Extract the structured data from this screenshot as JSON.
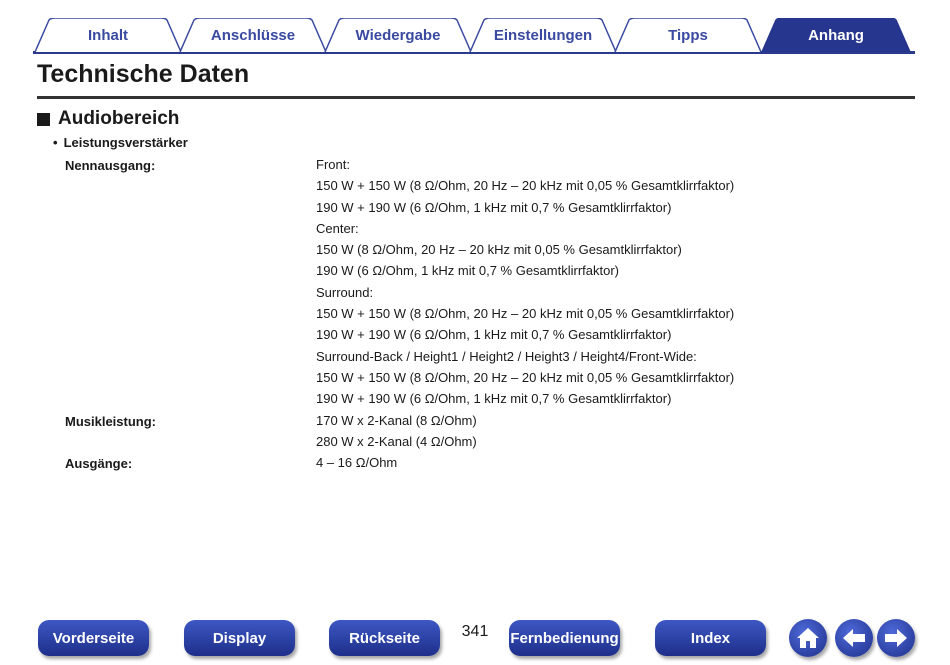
{
  "tabs": [
    {
      "label": "Inhalt"
    },
    {
      "label": "Anschlüsse"
    },
    {
      "label": "Wiedergabe"
    },
    {
      "label": "Einstellungen"
    },
    {
      "label": "Tipps"
    },
    {
      "label": "Anhang"
    }
  ],
  "active_tab": "Anhang",
  "page_title": "Technische Daten",
  "section": {
    "title": "Audiobereich"
  },
  "subsection": {
    "bullet": "•",
    "title": "Leistungsverstärker"
  },
  "specs": [
    {
      "label": "Nennausgang:",
      "lines": [
        "Front:",
        "150 W + 150 W (8 Ω/Ohm, 20 Hz – 20 kHz mit 0,05 % Gesamtklirrfaktor)",
        "190 W + 190 W (6 Ω/Ohm, 1 kHz mit 0,7 % Gesamtklirrfaktor)",
        "Center:",
        "150 W (8 Ω/Ohm, 20 Hz – 20 kHz mit 0,05 % Gesamtklirrfaktor)",
        "190 W (6 Ω/Ohm, 1 kHz mit 0,7 % Gesamtklirrfaktor)",
        "Surround:",
        "150 W + 150 W (8 Ω/Ohm, 20 Hz – 20 kHz mit 0,05 % Gesamtklirrfaktor)",
        "190 W + 190 W (6 Ω/Ohm, 1 kHz mit 0,7 % Gesamtklirrfaktor)",
        "Surround-Back / Height1 / Height2 / Height3 / Height4/Front-Wide:",
        "150 W + 150 W (8 Ω/Ohm, 20 Hz – 20 kHz mit 0,05 % Gesamtklirrfaktor)",
        "190 W + 190 W (6 Ω/Ohm, 1 kHz mit 0,7 % Gesamtklirrfaktor)"
      ]
    },
    {
      "label": "Musikleistung:",
      "lines": [
        "170 W x 2-Kanal (8 Ω/Ohm)",
        "280 W x 2-Kanal (4 Ω/Ohm)"
      ]
    },
    {
      "label": "Ausgänge:",
      "lines": [
        "4 – 16 Ω/Ohm"
      ]
    }
  ],
  "footer": {
    "buttons": [
      "Vorderseite",
      "Display",
      "Rückseite",
      "Fernbedienung",
      "Index"
    ],
    "page_number": "341",
    "icons": [
      "home-icon",
      "arrow-left-icon",
      "arrow-right-icon"
    ]
  },
  "colors": {
    "accent": "#2b3a8c",
    "button": "#2a3fa8",
    "active_tab": "#26368f"
  }
}
